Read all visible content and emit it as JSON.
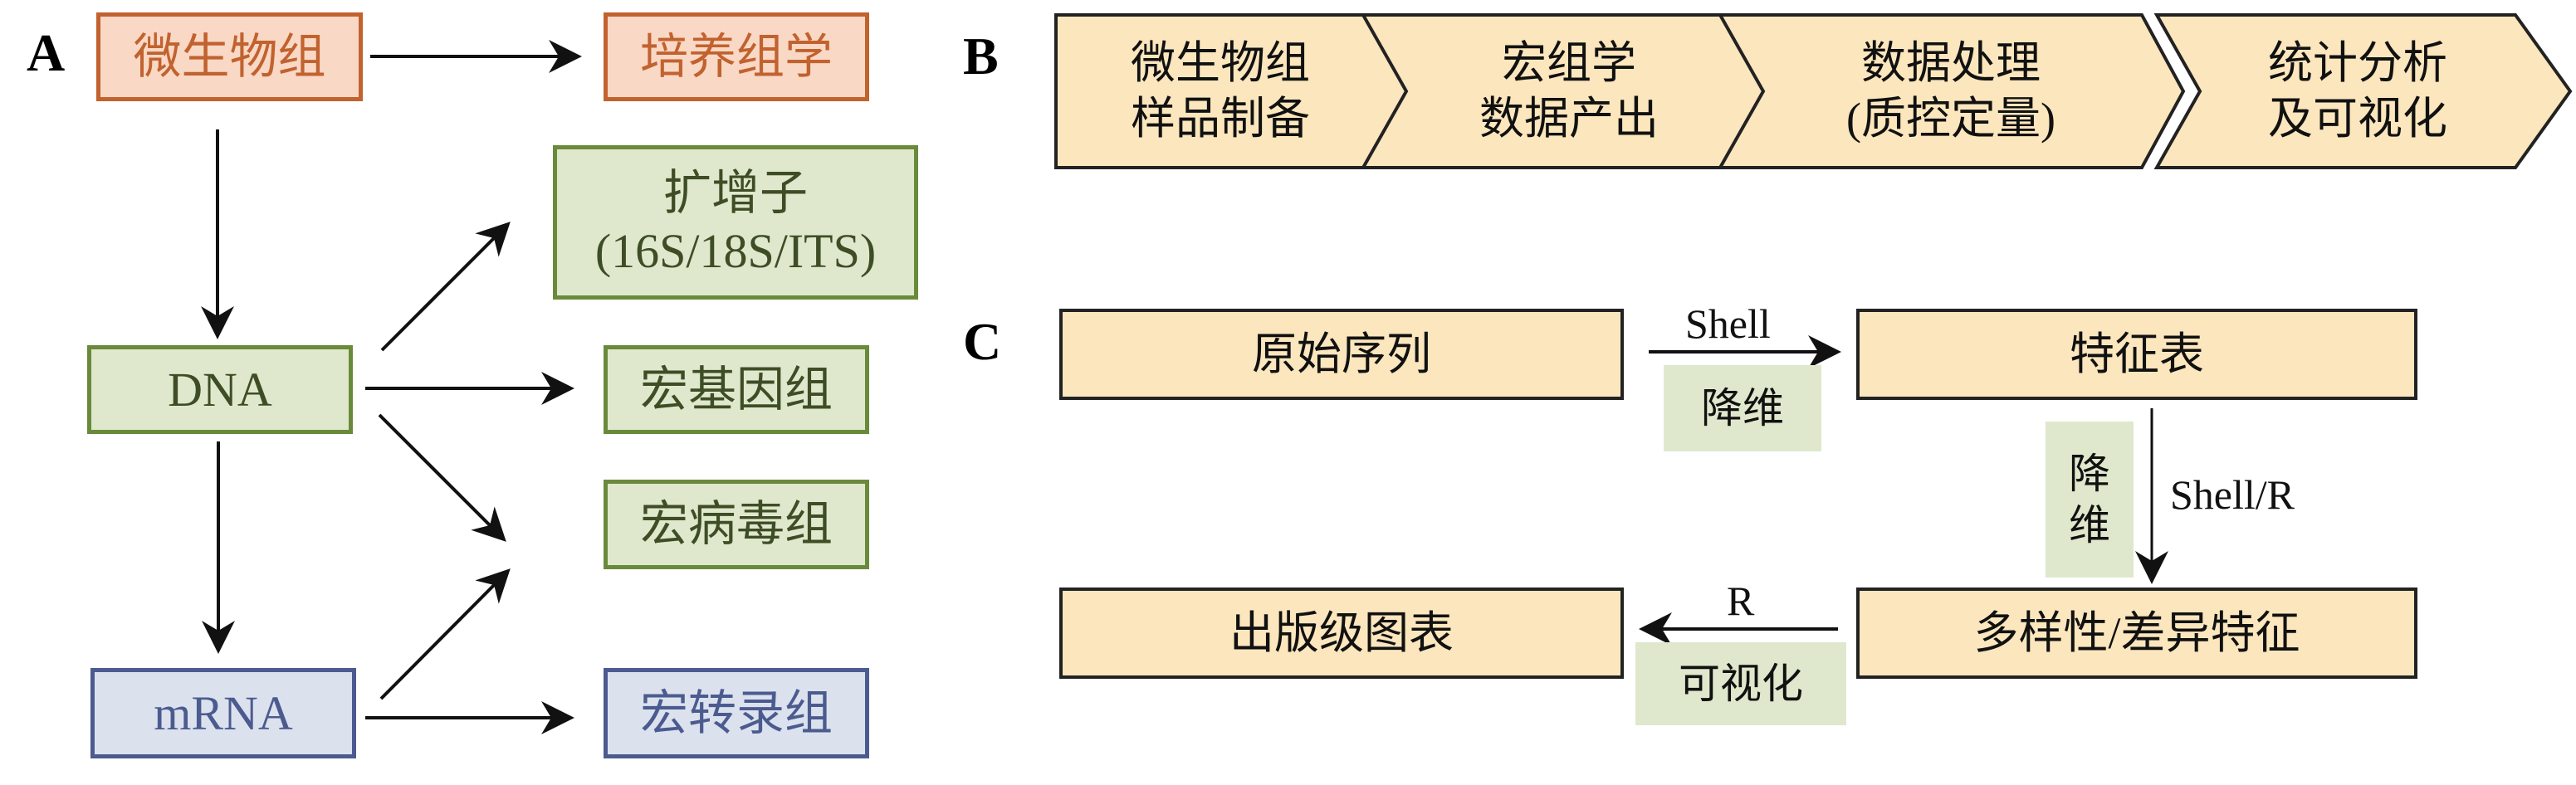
{
  "panels": {
    "a": "A",
    "b": "B",
    "c": "C"
  },
  "panel_a": {
    "microbiome": "微生物组",
    "culturomics": "培养组学",
    "amplicon_line1": "扩增子",
    "amplicon_line2": "(16S/18S/ITS)",
    "dna": "DNA",
    "metagenome": "宏基因组",
    "metavirome": "宏病毒组",
    "mrna": "mRNA",
    "metatranscriptome": "宏转录组"
  },
  "panel_b": {
    "steps": [
      {
        "line1": "微生物组",
        "line2": "样品制备"
      },
      {
        "line1": "宏组学",
        "line2": "数据产出"
      },
      {
        "line1": "数据处理",
        "line2": "(质控定量)"
      },
      {
        "line1": "统计分析",
        "line2": "及可视化"
      }
    ]
  },
  "panel_c": {
    "raw_sequences": "原始序列",
    "feature_table": "特征表",
    "diversity": "多样性/差异特征",
    "publication_figures": "出版级图表",
    "shell": "Shell",
    "shell_r": "Shell/R",
    "r": "R",
    "reduce_dim_1": "降维",
    "reduce_dim_2_line1": "降",
    "reduce_dim_2_line2": "维",
    "visualize": "可视化"
  },
  "colors": {
    "orange_fill": "#f9d8c5",
    "orange_border": "#c1622f",
    "green_fill": "#dfe8cc",
    "green_border": "#6a8a3b",
    "blue_fill": "#dbe2ee",
    "blue_border": "#4c5b8f",
    "beige_fill": "#fbe6bd"
  }
}
